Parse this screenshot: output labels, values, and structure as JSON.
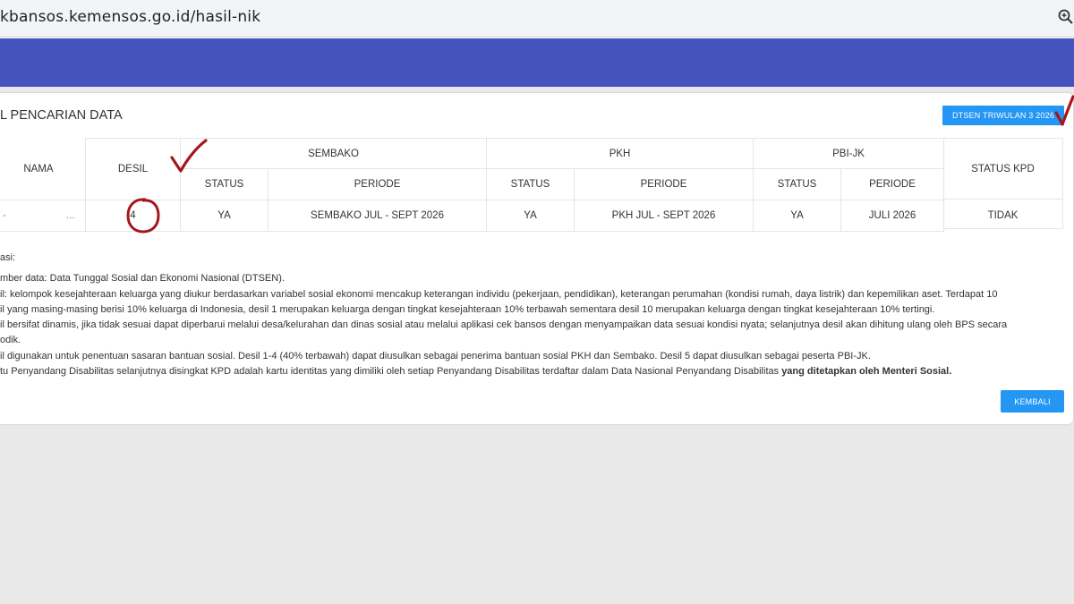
{
  "browser": {
    "url": "kbansos.kemensos.go.id/hasil-nik",
    "zoom_icon": "magnifier-zoom-icon"
  },
  "card": {
    "title": "L PENCARIAN DATA",
    "dtsen_button": "DTSEN TRIWULAN 3 2026",
    "back_button": "KEMBALI"
  },
  "table": {
    "headers": {
      "nama": "NAMA",
      "desil": "DESIL",
      "sembako": "SEMBAKO",
      "pkh": "PKH",
      "pbijk": "PBI-JK",
      "status_kpd": "STATUS KPD",
      "status": "STATUS",
      "periode": "PERIODE"
    },
    "row": {
      "nama_left": "-",
      "nama_right": "...",
      "desil": "4",
      "sembako_status": "YA",
      "sembako_periode": "SEMBAKO JUL - SEPT 2026",
      "pkh_status": "YA",
      "pkh_periode": "PKH JUL - SEPT 2026",
      "pbijk_status": "YA",
      "pbijk_periode": "JULI 2026",
      "status_kpd": "TIDAK"
    }
  },
  "notes": {
    "heading": "asi:",
    "line1": "mber data: Data Tunggal Sosial dan Ekonomi Nasional (DTSEN).",
    "line2": "il: kelompok kesejahteraan keluarga yang diukur berdasarkan variabel sosial ekonomi mencakup keterangan individu (pekerjaan, pendidikan), keterangan perumahan (kondisi rumah, daya listrik) dan kepemilikan aset. Terdapat 10",
    "line3": "il yang masing-masing berisi 10% keluarga di Indonesia, desil 1 merupakan keluarga dengan tingkat kesejahteraan 10% terbawah sementara desil 10 merupakan keluarga dengan tingkat kesejahteraan 10% tertingi.",
    "line4": "il bersifat dinamis, jika tidak sesuai dapat diperbarui melalui desa/kelurahan dan dinas sosial atau melalui aplikasi cek bansos dengan menyampaikan data sesuai kondisi nyata; selanjutnya desil akan dihitung ulang oleh BPS secara",
    "line5": "odik.",
    "line6": "il digunakan untuk penentuan sasaran bantuan sosial. Desil 1-4 (40% terbawah) dapat diusulkan sebagai penerima bantuan sosial PKH dan Sembako. Desil 5 dapat diusulkan sebagai peserta PBI-JK.",
    "line7_normal": "tu Penyandang Disabilitas selanjutnya disingkat KPD adalah kartu identitas yang dimiliki oleh setiap Penyandang Disabilitas terdaftar dalam Data Nasional Penyandang Disabilitas ",
    "line7_bold": "yang ditetapkan oleh Menteri Sosial."
  },
  "colors": {
    "banner": "#4553be",
    "button": "#2496f3",
    "annotation": "#a4161a"
  }
}
